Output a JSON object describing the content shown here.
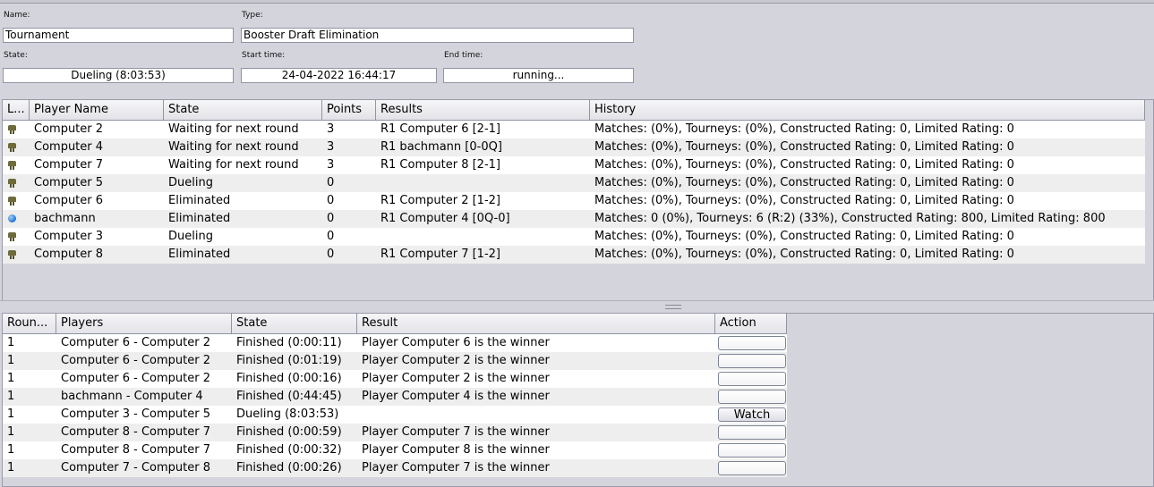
{
  "info": {
    "name_label": "Name:",
    "name_value": "Tournament",
    "type_label": "Type:",
    "type_value": "Booster Draft Elimination",
    "state_label": "State:",
    "state_value": "Dueling (8:03:53)",
    "start_label": "Start time:",
    "start_value": "24-04-2022 16:44:17",
    "end_label": "End time:",
    "end_value": "running..."
  },
  "players_table": {
    "columns": [
      "L...",
      "Player Name",
      "State",
      "Points",
      "Results",
      "History"
    ],
    "rows": [
      {
        "icon": "robot-icon",
        "name": "Computer 2",
        "state": "Waiting for next round",
        "points": "3",
        "results": "R1 Computer 6 [2-1]",
        "history": "Matches:  (0%), Tourneys:  (0%), Constructed Rating: 0, Limited Rating: 0"
      },
      {
        "icon": "robot-icon",
        "name": "Computer 4",
        "state": "Waiting for next round",
        "points": "3",
        "results": "R1 bachmann [0-0Q]",
        "history": "Matches:  (0%), Tourneys:  (0%), Constructed Rating: 0, Limited Rating: 0"
      },
      {
        "icon": "robot-icon",
        "name": "Computer 7",
        "state": "Waiting for next round",
        "points": "3",
        "results": "R1 Computer 8 [2-1]",
        "history": "Matches:  (0%), Tourneys:  (0%), Constructed Rating: 0, Limited Rating: 0"
      },
      {
        "icon": "robot-icon",
        "name": "Computer 5",
        "state": "Dueling",
        "points": "0",
        "results": "",
        "history": "Matches:  (0%), Tourneys:  (0%), Constructed Rating: 0, Limited Rating: 0"
      },
      {
        "icon": "robot-icon",
        "name": "Computer 6",
        "state": "Eliminated",
        "points": "0",
        "results": "R1 Computer 2 [1-2]",
        "history": "Matches:  (0%), Tourneys:  (0%), Constructed Rating: 0, Limited Rating: 0"
      },
      {
        "icon": "globe-icon",
        "name": "bachmann",
        "state": "Eliminated",
        "points": "0",
        "results": "R1 Computer 4 [0Q-0]",
        "history": "Matches: 0 (0%), Tourneys: 6 (R:2) (33%), Constructed Rating: 800, Limited Rating: 800"
      },
      {
        "icon": "robot-icon",
        "name": "Computer 3",
        "state": "Dueling",
        "points": "0",
        "results": "",
        "history": "Matches:  (0%), Tourneys:  (0%), Constructed Rating: 0, Limited Rating: 0"
      },
      {
        "icon": "robot-icon",
        "name": "Computer 8",
        "state": "Eliminated",
        "points": "0",
        "results": "R1 Computer 7 [1-2]",
        "history": "Matches:  (0%), Tourneys:  (0%), Constructed Rating: 0, Limited Rating: 0"
      }
    ]
  },
  "matches_table": {
    "columns": [
      "Roun...",
      "Players",
      "State",
      "Result",
      "Action"
    ],
    "rows": [
      {
        "round": "1",
        "players": "Computer 6 - Computer 2",
        "state": "Finished (0:00:11)",
        "result": "Player Computer 6 is the winner",
        "action": ""
      },
      {
        "round": "1",
        "players": "Computer 6 - Computer 2",
        "state": "Finished (0:01:19)",
        "result": "Player Computer 2 is the winner",
        "action": ""
      },
      {
        "round": "1",
        "players": "Computer 6 - Computer 2",
        "state": "Finished (0:00:16)",
        "result": "Player Computer 2 is the winner",
        "action": ""
      },
      {
        "round": "1",
        "players": "bachmann - Computer 4",
        "state": "Finished (0:44:45)",
        "result": "Player Computer 4 is the winner",
        "action": ""
      },
      {
        "round": "1",
        "players": "Computer 3 - Computer 5",
        "state": "Dueling (8:03:53)",
        "result": "",
        "action": "Watch"
      },
      {
        "round": "1",
        "players": "Computer 8 - Computer 7",
        "state": "Finished (0:00:59)",
        "result": "Player Computer 7 is the winner",
        "action": ""
      },
      {
        "round": "1",
        "players": "Computer 8 - Computer 7",
        "state": "Finished (0:00:32)",
        "result": "Player Computer 8 is the winner",
        "action": ""
      },
      {
        "round": "1",
        "players": "Computer 7 - Computer 8",
        "state": "Finished (0:00:26)",
        "result": "Player Computer 7 is the winner",
        "action": ""
      }
    ]
  }
}
